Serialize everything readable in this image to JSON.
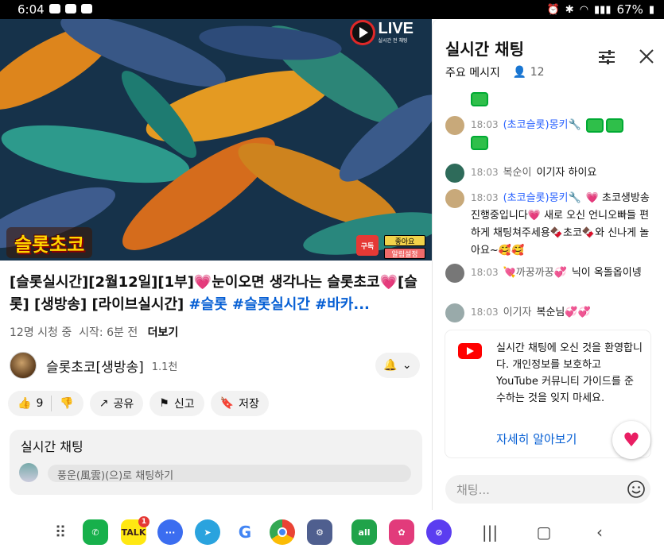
{
  "status_bar": {
    "time": "6:04",
    "battery": "67%",
    "network_label": "Wi-Fi"
  },
  "video": {
    "live_label": "LIVE",
    "live_sub": "실시간 전 채팅",
    "channel_logo_text": "슬롯초코",
    "subscribe_overlay": "구독",
    "like_overlay": "좋아요",
    "alarm_overlay": "알림설정"
  },
  "title": {
    "text_plain": "[슬롯실시간][2월12일][1부]💗눈이오면 생각나는 슬롯초코💗[슬롯] [생방송] [라이브실시간] ",
    "hashtags": "#슬롯 #슬롯실시간 #바카..."
  },
  "meta": {
    "views": "12명 시청 중",
    "started": "시작: 6분 전",
    "more_label": "더보기"
  },
  "channel": {
    "name": "슬롯초코[생방송]",
    "subs": "1.1천"
  },
  "actions": {
    "like_count": "9",
    "share_label": "공유",
    "report_label": "신고",
    "save_label": "저장"
  },
  "chat_card": {
    "header": "실시간 채팅",
    "placeholder": "풍운(風雲)(으)로 채팅하기"
  },
  "panel": {
    "title": "실시간 채팅",
    "filter_label": "주요 메시지",
    "viewer_count": "12",
    "messages": [
      {
        "time": "18:03",
        "author": "(초코슬롯)몽키🔧",
        "text": "",
        "mod": true
      },
      {
        "time": "18:03",
        "author": "복순이",
        "text": "이기자 하이요",
        "mod": false
      },
      {
        "time": "18:03",
        "author": "(초코슬롯)몽키🔧",
        "text": "💗 초코생방송 진행중입니다💗 새로 오신 언니오빠들 편하게 채팅쳐주세용🍫초코🍫와 신나게 놀아요~🥰🥰",
        "mod": true
      },
      {
        "time": "18:03",
        "author": "💘까꿍까꿍💞",
        "text": "닉이 옥돌옵이넹",
        "mod": false
      },
      {
        "time": "18:03",
        "author": "이기자",
        "text": "복순님💞💞",
        "mod": false
      }
    ],
    "notice": {
      "text": "실시간 채팅에 오신 것을 환영합니다. 개인정보를 보호하고 YouTube 커뮤니티 가이드를 준수하는 것을 잊지 마세요.",
      "link": "자세히 알아보기"
    },
    "input_placeholder": "채팅..."
  },
  "navbar": {
    "talk_badge": "1",
    "apps": [
      "phone-app",
      "kakaotalk-app",
      "messages-app",
      "telegram-app",
      "google-app",
      "chrome-app",
      "settings-app",
      "allone-app",
      "flower-app",
      "samsung-internet-app"
    ]
  },
  "colors": {
    "accent_blue": "#065fd4",
    "live_red": "#e02828",
    "heart_pink": "#e91e63",
    "youtube_red": "#ff0000"
  }
}
